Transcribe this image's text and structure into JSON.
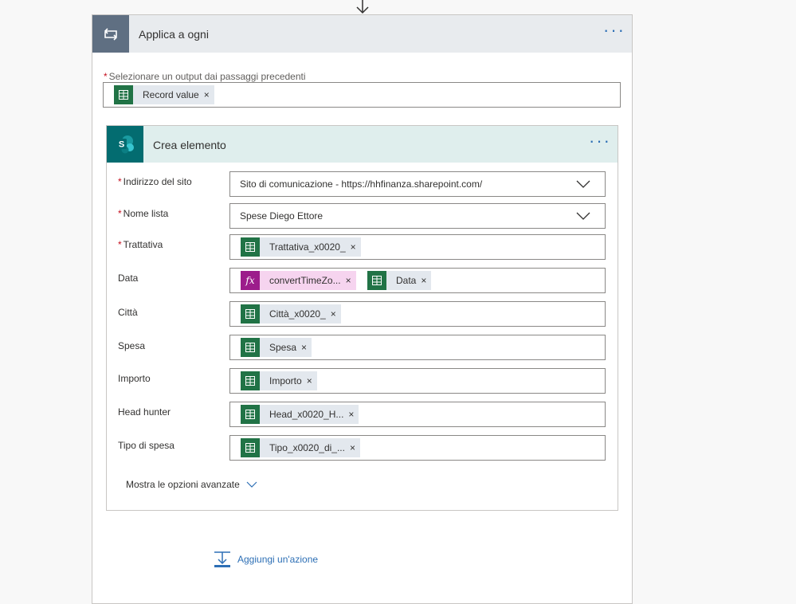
{
  "apply_each": {
    "title": "Applica a ogni",
    "menu_dots": "···",
    "output_label": "Selezionare un output dai passaggi precedenti",
    "required_mark": "*",
    "output_token": {
      "label": "Record value",
      "close": "×",
      "icon": "excel-table-icon"
    }
  },
  "create_item": {
    "title": "Crea elemento",
    "menu_dots": "···",
    "icon_letter": "S",
    "fields": [
      {
        "label": "Indirizzo del sito",
        "required": true,
        "value": "Sito di comunicazione - https://hhfinanza.sharepoint.com/",
        "dropdown": true
      },
      {
        "label": "Nome lista",
        "required": true,
        "value": "Spese Diego Ettore",
        "dropdown": true
      },
      {
        "label": "Trattativa",
        "required": true,
        "tokens": [
          {
            "label": "Trattativa_x0020_",
            "type": "excel"
          }
        ]
      },
      {
        "label": "Data",
        "required": false,
        "tokens": [
          {
            "label": "convertTimeZo...",
            "type": "fx"
          },
          {
            "label": "Data",
            "type": "excel"
          }
        ]
      },
      {
        "label": "Città",
        "required": false,
        "tokens": [
          {
            "label": "Città_x0020_",
            "type": "excel"
          }
        ]
      },
      {
        "label": "Spesa",
        "required": false,
        "tokens": [
          {
            "label": "Spesa",
            "type": "excel"
          }
        ]
      },
      {
        "label": "Importo",
        "required": false,
        "tokens": [
          {
            "label": "Importo",
            "type": "excel"
          }
        ]
      },
      {
        "label": "Head hunter",
        "required": false,
        "tokens": [
          {
            "label": "Head_x0020_H...",
            "type": "excel"
          }
        ]
      },
      {
        "label": "Tipo di spesa",
        "required": false,
        "tokens": [
          {
            "label": "Tipo_x0020_di_...",
            "type": "excel"
          }
        ]
      }
    ],
    "advanced_label": "Mostra le opzioni avanzate",
    "token_close": "×",
    "fx_glyph": "fx"
  },
  "add_action_label": "Aggiungi un'azione",
  "colors": {
    "accent": "#2d6fb5",
    "excel": "#217346",
    "sharepoint": "#036c70",
    "fx": "#9c1d8b",
    "required": "#c50f1f"
  }
}
